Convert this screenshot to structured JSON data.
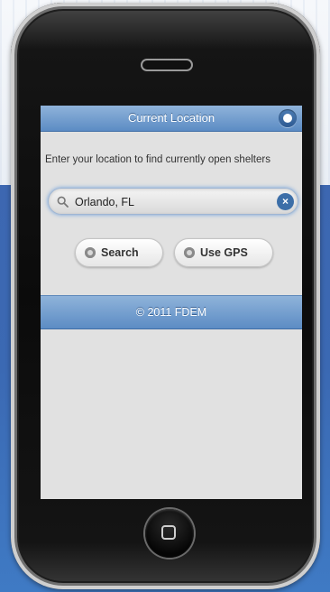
{
  "header": {
    "title": "Current Location",
    "button_icon": "info-dot-icon"
  },
  "instructions": "Enter your location to find currently open shelters",
  "search": {
    "value": "Orlando, FL",
    "placeholder": "",
    "clear_label": "×"
  },
  "actions": {
    "search_label": "Search",
    "gps_label": "Use GPS"
  },
  "footer": {
    "text": "© 2011 FDEM"
  },
  "colors": {
    "bar_top": "#8fb3da",
    "bar_bottom": "#5c8cc4",
    "clear_button": "#3c6ea8",
    "content_background": "#e1e1e1",
    "page_blue": "#3d67b1"
  }
}
